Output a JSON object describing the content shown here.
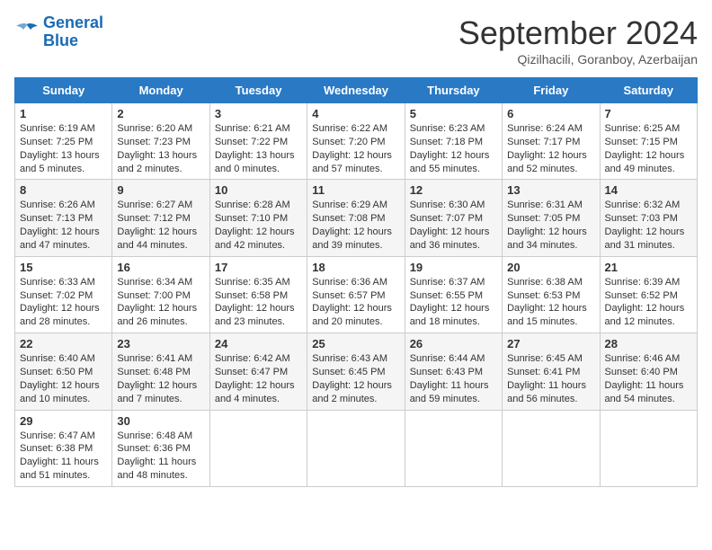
{
  "header": {
    "logo_line1": "General",
    "logo_line2": "Blue",
    "month": "September 2024",
    "location": "Qizilhacili, Goranboy, Azerbaijan"
  },
  "weekdays": [
    "Sunday",
    "Monday",
    "Tuesday",
    "Wednesday",
    "Thursday",
    "Friday",
    "Saturday"
  ],
  "weeks": [
    [
      {
        "day": "1",
        "sunrise": "Sunrise: 6:19 AM",
        "sunset": "Sunset: 7:25 PM",
        "daylight": "Daylight: 13 hours and 5 minutes."
      },
      {
        "day": "2",
        "sunrise": "Sunrise: 6:20 AM",
        "sunset": "Sunset: 7:23 PM",
        "daylight": "Daylight: 13 hours and 2 minutes."
      },
      {
        "day": "3",
        "sunrise": "Sunrise: 6:21 AM",
        "sunset": "Sunset: 7:22 PM",
        "daylight": "Daylight: 13 hours and 0 minutes."
      },
      {
        "day": "4",
        "sunrise": "Sunrise: 6:22 AM",
        "sunset": "Sunset: 7:20 PM",
        "daylight": "Daylight: 12 hours and 57 minutes."
      },
      {
        "day": "5",
        "sunrise": "Sunrise: 6:23 AM",
        "sunset": "Sunset: 7:18 PM",
        "daylight": "Daylight: 12 hours and 55 minutes."
      },
      {
        "day": "6",
        "sunrise": "Sunrise: 6:24 AM",
        "sunset": "Sunset: 7:17 PM",
        "daylight": "Daylight: 12 hours and 52 minutes."
      },
      {
        "day": "7",
        "sunrise": "Sunrise: 6:25 AM",
        "sunset": "Sunset: 7:15 PM",
        "daylight": "Daylight: 12 hours and 49 minutes."
      }
    ],
    [
      {
        "day": "8",
        "sunrise": "Sunrise: 6:26 AM",
        "sunset": "Sunset: 7:13 PM",
        "daylight": "Daylight: 12 hours and 47 minutes."
      },
      {
        "day": "9",
        "sunrise": "Sunrise: 6:27 AM",
        "sunset": "Sunset: 7:12 PM",
        "daylight": "Daylight: 12 hours and 44 minutes."
      },
      {
        "day": "10",
        "sunrise": "Sunrise: 6:28 AM",
        "sunset": "Sunset: 7:10 PM",
        "daylight": "Daylight: 12 hours and 42 minutes."
      },
      {
        "day": "11",
        "sunrise": "Sunrise: 6:29 AM",
        "sunset": "Sunset: 7:08 PM",
        "daylight": "Daylight: 12 hours and 39 minutes."
      },
      {
        "day": "12",
        "sunrise": "Sunrise: 6:30 AM",
        "sunset": "Sunset: 7:07 PM",
        "daylight": "Daylight: 12 hours and 36 minutes."
      },
      {
        "day": "13",
        "sunrise": "Sunrise: 6:31 AM",
        "sunset": "Sunset: 7:05 PM",
        "daylight": "Daylight: 12 hours and 34 minutes."
      },
      {
        "day": "14",
        "sunrise": "Sunrise: 6:32 AM",
        "sunset": "Sunset: 7:03 PM",
        "daylight": "Daylight: 12 hours and 31 minutes."
      }
    ],
    [
      {
        "day": "15",
        "sunrise": "Sunrise: 6:33 AM",
        "sunset": "Sunset: 7:02 PM",
        "daylight": "Daylight: 12 hours and 28 minutes."
      },
      {
        "day": "16",
        "sunrise": "Sunrise: 6:34 AM",
        "sunset": "Sunset: 7:00 PM",
        "daylight": "Daylight: 12 hours and 26 minutes."
      },
      {
        "day": "17",
        "sunrise": "Sunrise: 6:35 AM",
        "sunset": "Sunset: 6:58 PM",
        "daylight": "Daylight: 12 hours and 23 minutes."
      },
      {
        "day": "18",
        "sunrise": "Sunrise: 6:36 AM",
        "sunset": "Sunset: 6:57 PM",
        "daylight": "Daylight: 12 hours and 20 minutes."
      },
      {
        "day": "19",
        "sunrise": "Sunrise: 6:37 AM",
        "sunset": "Sunset: 6:55 PM",
        "daylight": "Daylight: 12 hours and 18 minutes."
      },
      {
        "day": "20",
        "sunrise": "Sunrise: 6:38 AM",
        "sunset": "Sunset: 6:53 PM",
        "daylight": "Daylight: 12 hours and 15 minutes."
      },
      {
        "day": "21",
        "sunrise": "Sunrise: 6:39 AM",
        "sunset": "Sunset: 6:52 PM",
        "daylight": "Daylight: 12 hours and 12 minutes."
      }
    ],
    [
      {
        "day": "22",
        "sunrise": "Sunrise: 6:40 AM",
        "sunset": "Sunset: 6:50 PM",
        "daylight": "Daylight: 12 hours and 10 minutes."
      },
      {
        "day": "23",
        "sunrise": "Sunrise: 6:41 AM",
        "sunset": "Sunset: 6:48 PM",
        "daylight": "Daylight: 12 hours and 7 minutes."
      },
      {
        "day": "24",
        "sunrise": "Sunrise: 6:42 AM",
        "sunset": "Sunset: 6:47 PM",
        "daylight": "Daylight: 12 hours and 4 minutes."
      },
      {
        "day": "25",
        "sunrise": "Sunrise: 6:43 AM",
        "sunset": "Sunset: 6:45 PM",
        "daylight": "Daylight: 12 hours and 2 minutes."
      },
      {
        "day": "26",
        "sunrise": "Sunrise: 6:44 AM",
        "sunset": "Sunset: 6:43 PM",
        "daylight": "Daylight: 11 hours and 59 minutes."
      },
      {
        "day": "27",
        "sunrise": "Sunrise: 6:45 AM",
        "sunset": "Sunset: 6:41 PM",
        "daylight": "Daylight: 11 hours and 56 minutes."
      },
      {
        "day": "28",
        "sunrise": "Sunrise: 6:46 AM",
        "sunset": "Sunset: 6:40 PM",
        "daylight": "Daylight: 11 hours and 54 minutes."
      }
    ],
    [
      {
        "day": "29",
        "sunrise": "Sunrise: 6:47 AM",
        "sunset": "Sunset: 6:38 PM",
        "daylight": "Daylight: 11 hours and 51 minutes."
      },
      {
        "day": "30",
        "sunrise": "Sunrise: 6:48 AM",
        "sunset": "Sunset: 6:36 PM",
        "daylight": "Daylight: 11 hours and 48 minutes."
      },
      null,
      null,
      null,
      null,
      null
    ]
  ]
}
